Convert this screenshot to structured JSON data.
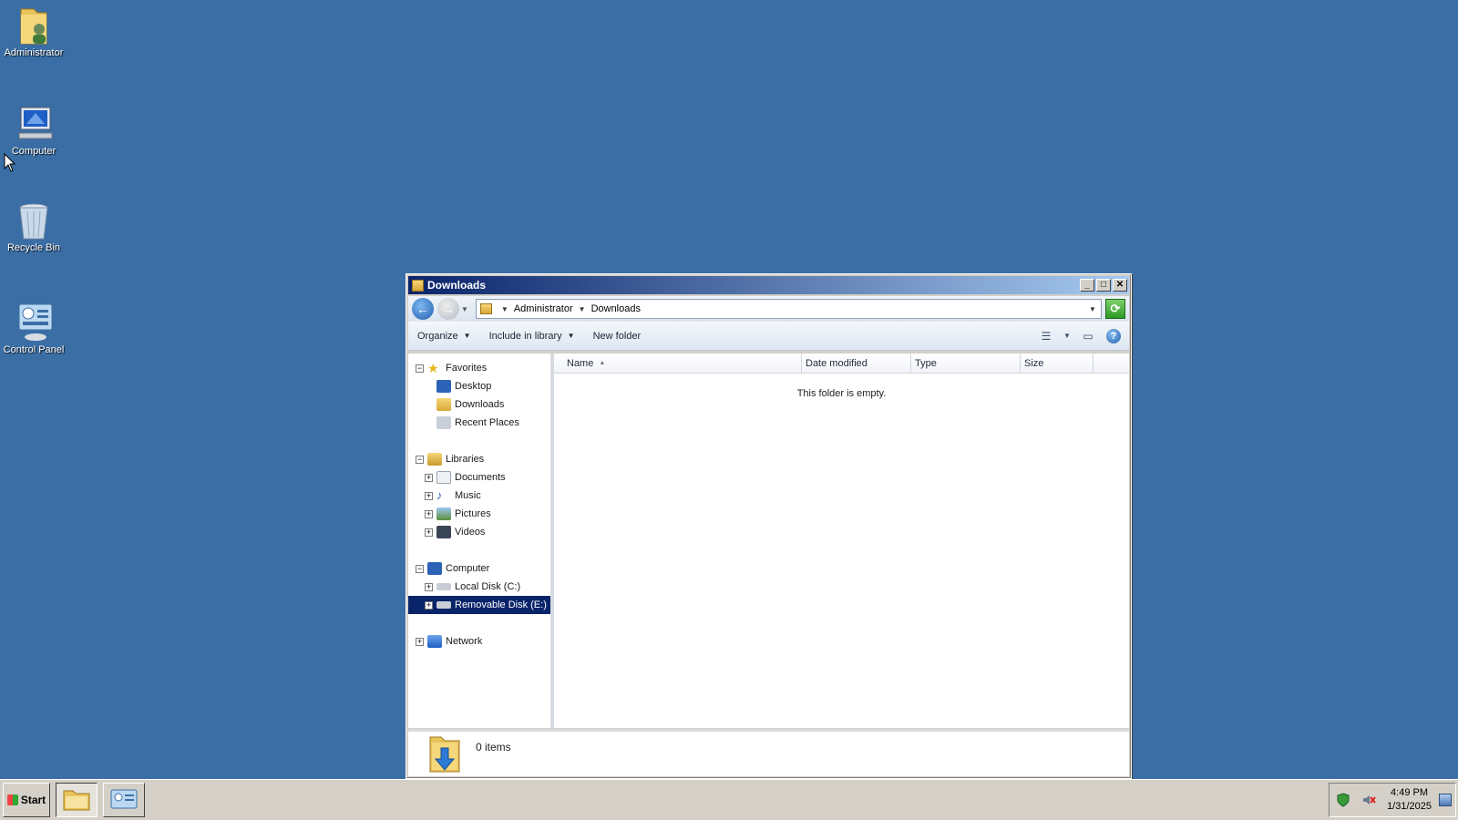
{
  "desktop": {
    "icons": [
      {
        "label": "Administrator",
        "icon": "user-folder-icon"
      },
      {
        "label": "Computer",
        "icon": "computer-icon"
      },
      {
        "label": "Recycle Bin",
        "icon": "recycle-bin-icon"
      },
      {
        "label": "Control Panel",
        "icon": "control-panel-icon"
      }
    ]
  },
  "window": {
    "title": "Downloads",
    "address": {
      "crumbs": [
        "Administrator",
        "Downloads"
      ]
    },
    "toolbar": {
      "organize": "Organize",
      "include_in_library": "Include in library",
      "new_folder": "New folder",
      "help": "?"
    },
    "nav": {
      "favorites": "Favorites",
      "favorites_items": [
        "Desktop",
        "Downloads",
        "Recent Places"
      ],
      "libraries": "Libraries",
      "libraries_items": [
        "Documents",
        "Music",
        "Pictures",
        "Videos"
      ],
      "computer": "Computer",
      "computer_items": [
        "Local Disk (C:)",
        "Removable Disk (E:)"
      ],
      "selected": "Removable Disk (E:)",
      "network": "Network"
    },
    "columns": [
      "Name",
      "Date modified",
      "Type",
      "Size"
    ],
    "empty_message": "This folder is empty.",
    "details": {
      "item_count": "0 items"
    }
  },
  "taskbar": {
    "start": "Start",
    "clock_time": "4:49 PM",
    "clock_date": "1/31/2025"
  }
}
